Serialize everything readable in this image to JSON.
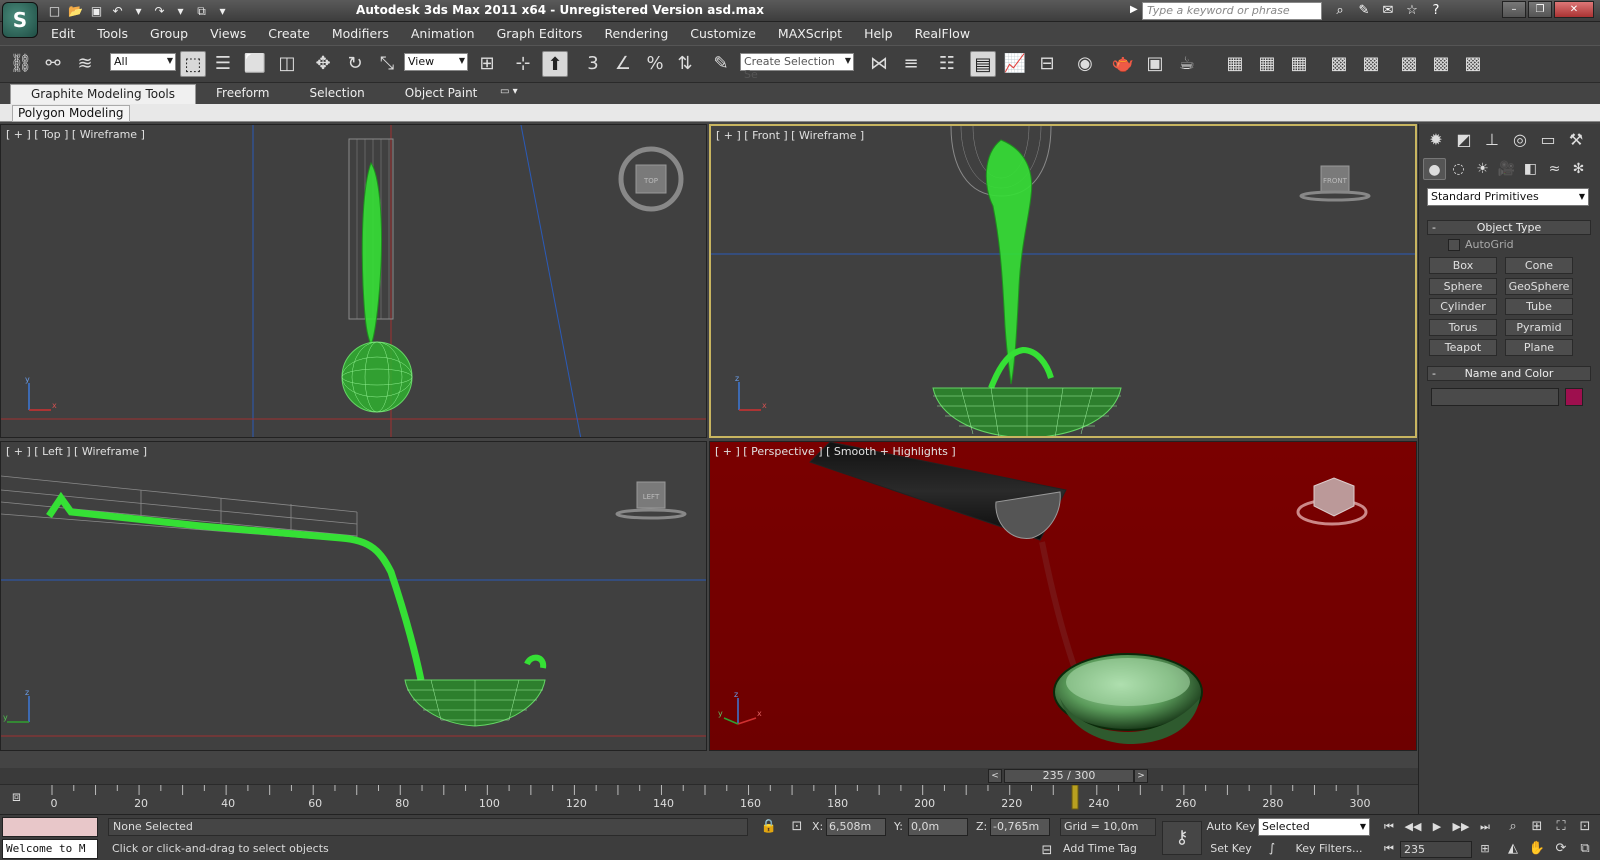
{
  "window": {
    "title": "Autodesk 3ds Max  2011 x64  -  Unregistered Version    asd.max",
    "search_placeholder": "Type a keyword or phrase"
  },
  "menu": [
    "Edit",
    "Tools",
    "Group",
    "Views",
    "Create",
    "Modifiers",
    "Animation",
    "Graph Editors",
    "Rendering",
    "Customize",
    "MAXScript",
    "Help",
    "RealFlow"
  ],
  "toolbar": {
    "selection_filter": "All",
    "reference_coord": "View",
    "named_selection_placeholder": "Create Selection Se"
  },
  "ribbon": {
    "tabs": [
      "Graphite Modeling Tools",
      "Freeform",
      "Selection",
      "Object Paint"
    ],
    "panel_label": "Polygon Modeling"
  },
  "viewports": {
    "top": {
      "label": "[ + ] [ Top ] [ Wireframe ]",
      "cube": "TOP"
    },
    "front": {
      "label": "[ + ] [ Front ] [ Wireframe ]",
      "cube": "FRONT"
    },
    "left": {
      "label": "[ + ] [ Left ] [ Wireframe ]",
      "cube": "LEFT"
    },
    "perspective": {
      "label": "[ + ] [ Perspective ] [ Smooth + Highlights ]"
    },
    "axis_x": "x",
    "axis_y": "y",
    "axis_z": "z"
  },
  "command_panel": {
    "category_dropdown": "Standard Primitives",
    "object_type_title": "Object Type",
    "autogrid_label": "AutoGrid",
    "buttons": [
      "Box",
      "Cone",
      "Sphere",
      "GeoSphere",
      "Cylinder",
      "Tube",
      "Torus",
      "Pyramid",
      "Teapot",
      "Plane"
    ],
    "name_color_title": "Name and Color",
    "object_color": "#9e0f4e"
  },
  "timeline": {
    "frame_display": "235 / 300",
    "current_frame": 235,
    "total_frames": 300,
    "ticks": [
      "0",
      "20",
      "40",
      "60",
      "80",
      "100",
      "120",
      "140",
      "160",
      "180",
      "200",
      "220",
      "240",
      "260",
      "280",
      "300"
    ]
  },
  "status": {
    "listener_text": "Welcome to M",
    "selection_status": "None Selected",
    "prompt": "Click or click-and-drag to select objects",
    "x_label": "X:",
    "x_value": "6,508m",
    "y_label": "Y:",
    "y_value": "0,0m",
    "z_label": "Z:",
    "z_value": "-0,765m",
    "grid": "Grid = 10,0m",
    "add_time_tag": "Add Time Tag",
    "auto_key": "Auto Key",
    "set_key": "Set Key",
    "key_mode": "Selected",
    "key_filters": "Key Filters...",
    "frame_value": "235"
  },
  "colors": {
    "wire_green": "#35e035",
    "perspective_bg": "#6e0000",
    "active_border": "#c8b560"
  }
}
